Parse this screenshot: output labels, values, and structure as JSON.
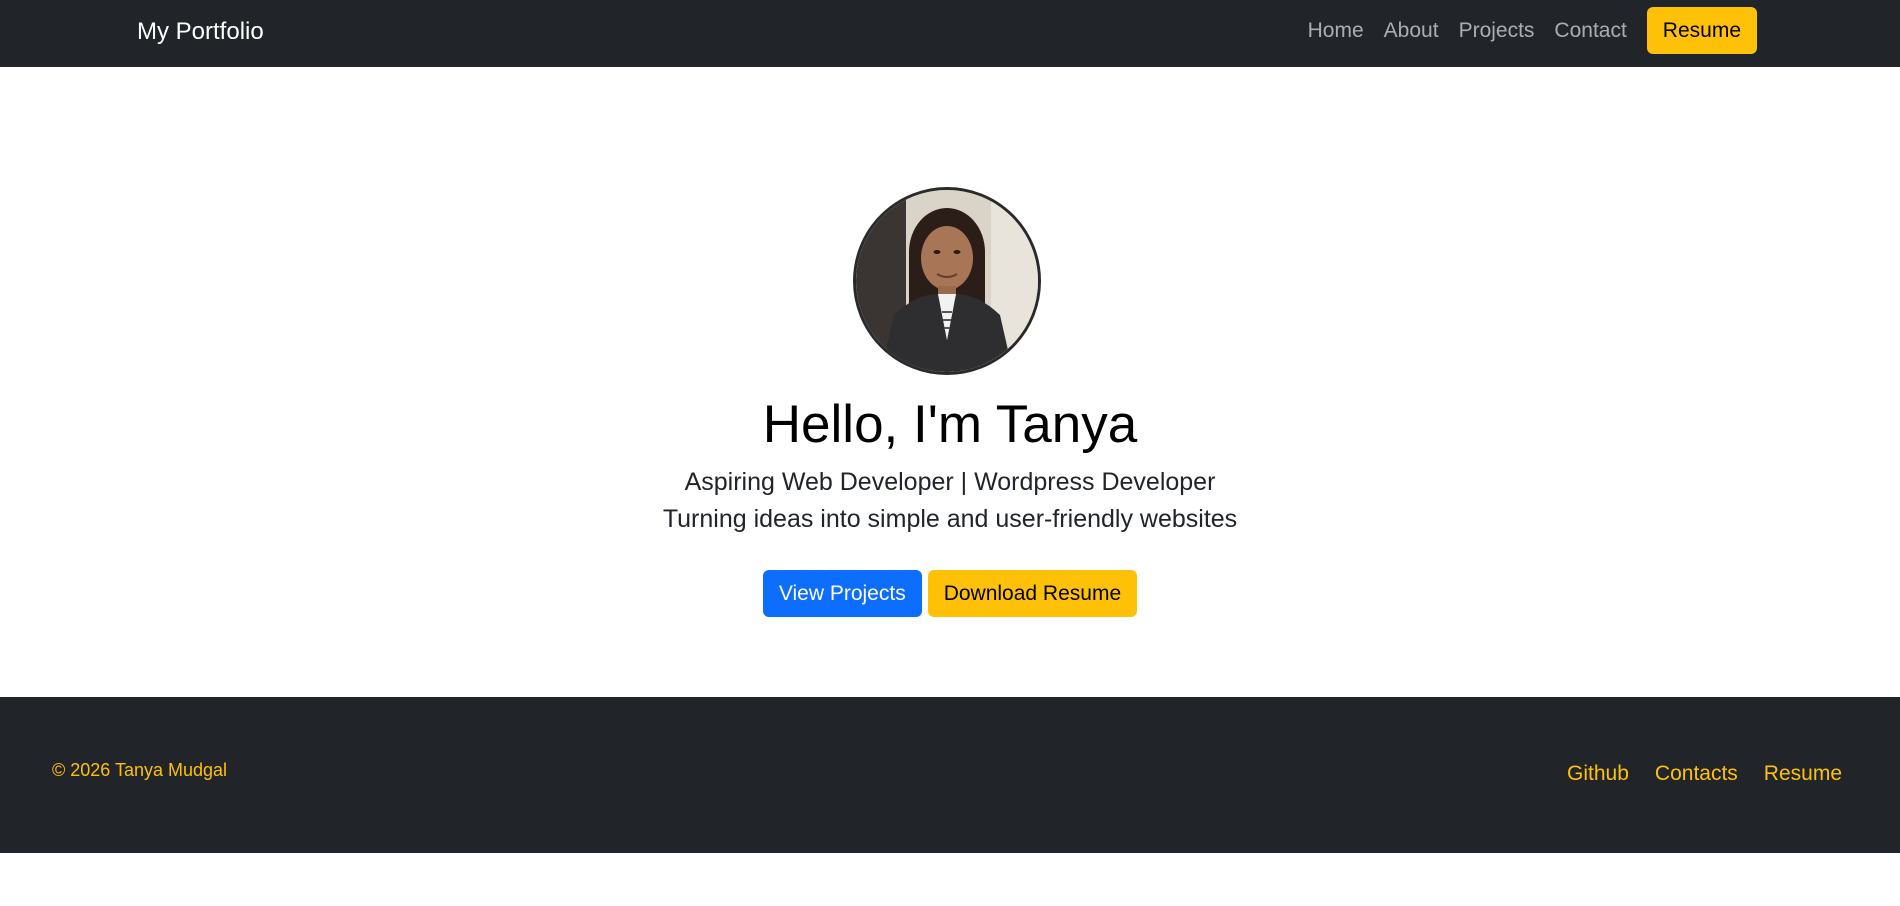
{
  "navbar": {
    "brand": "My Portfolio",
    "links": [
      "Home",
      "About",
      "Projects",
      "Contact"
    ],
    "resume_button": "Resume"
  },
  "hero": {
    "avatar_icon": "profile-photo",
    "title": "Hello, I'm Tanya",
    "subtitle_1": "Aspiring Web Developer | Wordpress Developer",
    "subtitle_2": "Turning ideas into simple and user-friendly websites",
    "view_projects_button": "View Projects",
    "download_resume_button": "Download Resume"
  },
  "footer": {
    "copyright": "© 2026 Tanya Mudgal",
    "links": [
      "Github",
      "Contacts",
      "Resume"
    ]
  },
  "colors": {
    "dark": "#212529",
    "accent_yellow": "#ffc107",
    "primary_blue": "#0d6efd",
    "white": "#ffffff"
  }
}
